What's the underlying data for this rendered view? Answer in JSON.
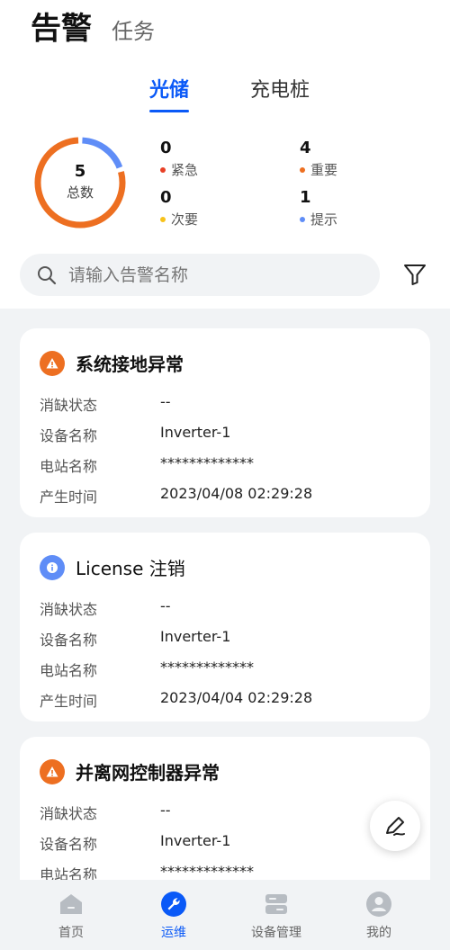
{
  "header": {
    "title": "告警",
    "tab2": "任务"
  },
  "subtabs": [
    {
      "label": "光储",
      "active": true
    },
    {
      "label": "充电桩",
      "active": false
    }
  ],
  "summary": {
    "total": "5",
    "total_label": "总数",
    "stats": [
      {
        "count": "0",
        "label": "紧急",
        "color": "#e84026"
      },
      {
        "count": "4",
        "label": "重要",
        "color": "#ed6f21"
      },
      {
        "count": "0",
        "label": "次要",
        "color": "#f7c21a"
      },
      {
        "count": "1",
        "label": "提示",
        "color": "#5f8df7"
      }
    ],
    "donut_segments": [
      {
        "label": "重要",
        "value": 4,
        "color": "#ed6f21"
      },
      {
        "label": "提示",
        "value": 1,
        "color": "#5f8df7"
      }
    ]
  },
  "search": {
    "placeholder": "请输入告警名称"
  },
  "alarms": [
    {
      "icon": "warning-icon",
      "title": "系统接地异常",
      "fields": [
        {
          "k": "消缺状态",
          "v": "--"
        },
        {
          "k": "设备名称",
          "v": "Inverter-1"
        },
        {
          "k": "电站名称",
          "v": "*************"
        },
        {
          "k": "产生时间",
          "v": "2023/04/08 02:29:28"
        }
      ]
    },
    {
      "icon": "info-icon",
      "title": "License 注销",
      "fields": [
        {
          "k": "消缺状态",
          "v": "--"
        },
        {
          "k": "设备名称",
          "v": "Inverter-1"
        },
        {
          "k": "电站名称",
          "v": "*************"
        },
        {
          "k": "产生时间",
          "v": "2023/04/04 02:29:28"
        }
      ]
    },
    {
      "icon": "warning-icon",
      "title": "并离网控制器异常",
      "fields": [
        {
          "k": "消缺状态",
          "v": "--"
        },
        {
          "k": "设备名称",
          "v": "Inverter-1"
        },
        {
          "k": "电站名称",
          "v": "*************"
        }
      ]
    }
  ],
  "nav": [
    {
      "label": "首页",
      "icon": "home-icon",
      "active": false
    },
    {
      "label": "运维",
      "icon": "wrench-icon",
      "active": true
    },
    {
      "label": "设备管理",
      "icon": "device-icon",
      "active": false
    },
    {
      "label": "我的",
      "icon": "user-icon",
      "active": false
    }
  ],
  "colors": {
    "accent": "#0a59f7",
    "warning": "#ed6f21",
    "info": "#5f8df7"
  }
}
